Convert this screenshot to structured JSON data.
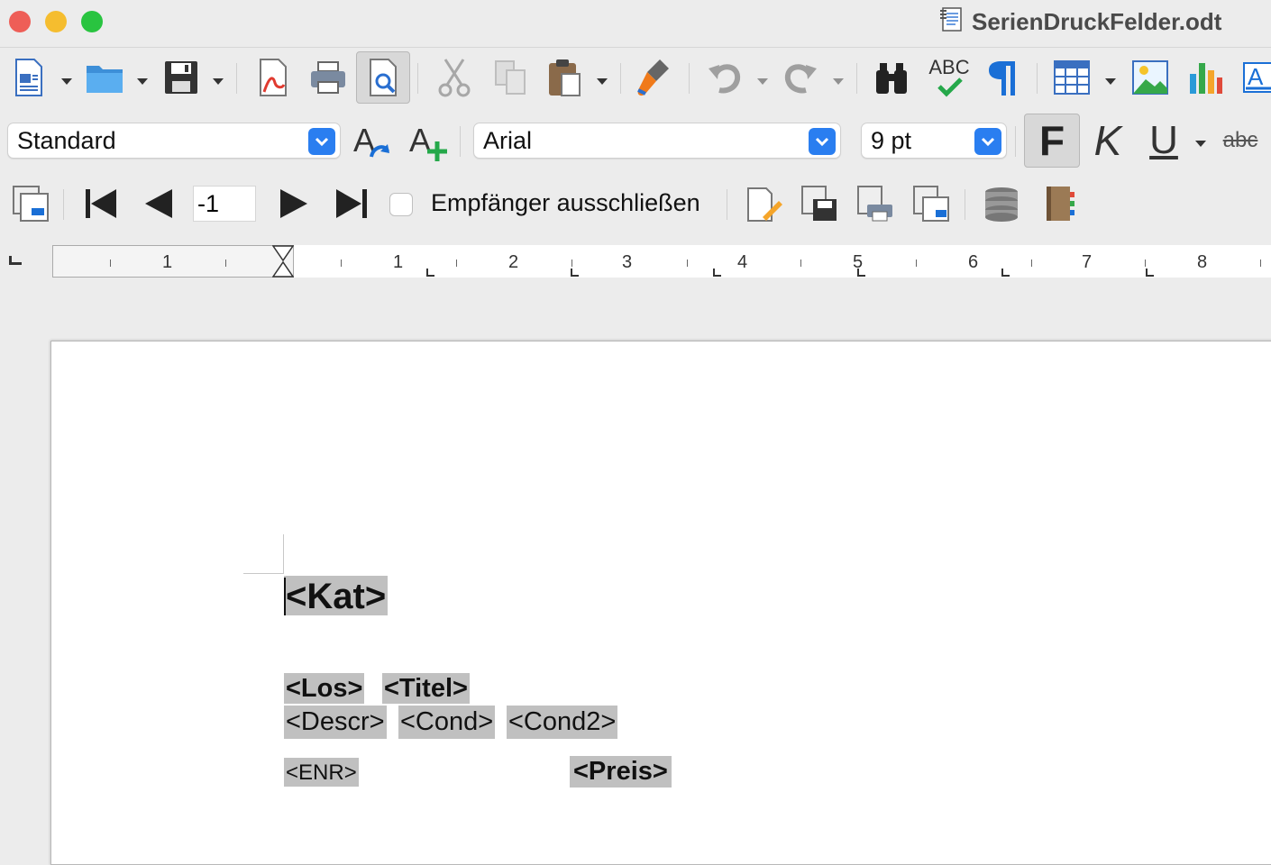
{
  "window": {
    "title": "SerienDruckFelder.odt",
    "colors": {
      "close": "#ee5e57",
      "minimize": "#f5bd2f",
      "maximize": "#29c440"
    }
  },
  "toolbar_standard": {
    "icons": [
      "new-document-icon",
      "open-folder-icon",
      "save-icon",
      "export-pdf-icon",
      "print-icon",
      "print-preview-icon",
      "cut-icon",
      "copy-icon",
      "paste-icon",
      "clone-formatting-icon",
      "undo-icon",
      "redo-icon",
      "find-replace-icon",
      "spelling-icon",
      "formatting-marks-icon",
      "insert-table-icon",
      "insert-image-icon",
      "insert-chart-icon",
      "insert-text-box-icon"
    ],
    "spell_label": "ABC"
  },
  "toolbar_formatting": {
    "paragraph_style": "Standard",
    "font_name": "Arial",
    "font_size": "9 pt",
    "bold_label": "F",
    "italic_label": "K",
    "underline_label": "U",
    "strikethrough_label": "abc"
  },
  "toolbar_mailmerge": {
    "record_number": "-1",
    "exclude_label": "Empfänger ausschließen",
    "exclude_checked": false
  },
  "ruler": {
    "left_numbers": [
      "1"
    ],
    "numbers": [
      "1",
      "2",
      "3",
      "4",
      "5",
      "6",
      "7",
      "8"
    ]
  },
  "document": {
    "fields": {
      "kat": "<Kat>",
      "los": "<Los>",
      "titel": "<Titel>",
      "descr": "<Descr>",
      "cond": "<Cond>",
      "cond2": "<Cond2>",
      "enr": "<ENR>",
      "preis": "<Preis>"
    },
    "field_shading": "#c0c0c0"
  }
}
